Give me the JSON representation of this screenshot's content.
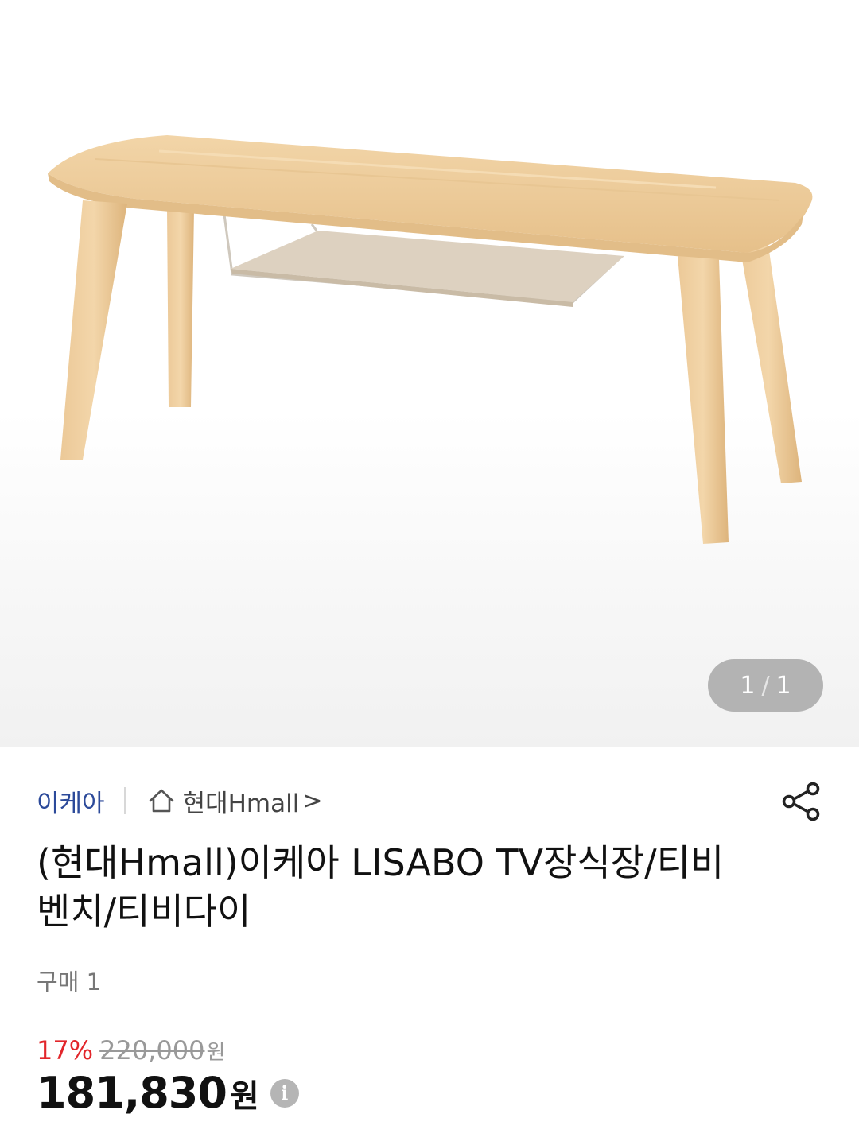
{
  "gallery": {
    "image_alt": "LISABO TV bench",
    "current": "1",
    "separator": "/",
    "total": "1"
  },
  "brand": {
    "name": "이케아",
    "store_name": "현대Hmall",
    "store_arrow": ">",
    "home_icon": "home-icon",
    "share_icon": "share-icon"
  },
  "product": {
    "title": "(현대Hmall)이케아 LISABO TV장식장/티비벤치/티비다이",
    "purchase_count": "구매 1"
  },
  "price": {
    "discount": "17%",
    "original": "220,000",
    "original_unit": "원",
    "sale": "181,830",
    "sale_unit": "원",
    "info_icon": "info-icon"
  },
  "colors": {
    "brand_link": "#2c4a9a",
    "discount": "#e2262b",
    "counter_bg": "#b3b3b3"
  }
}
